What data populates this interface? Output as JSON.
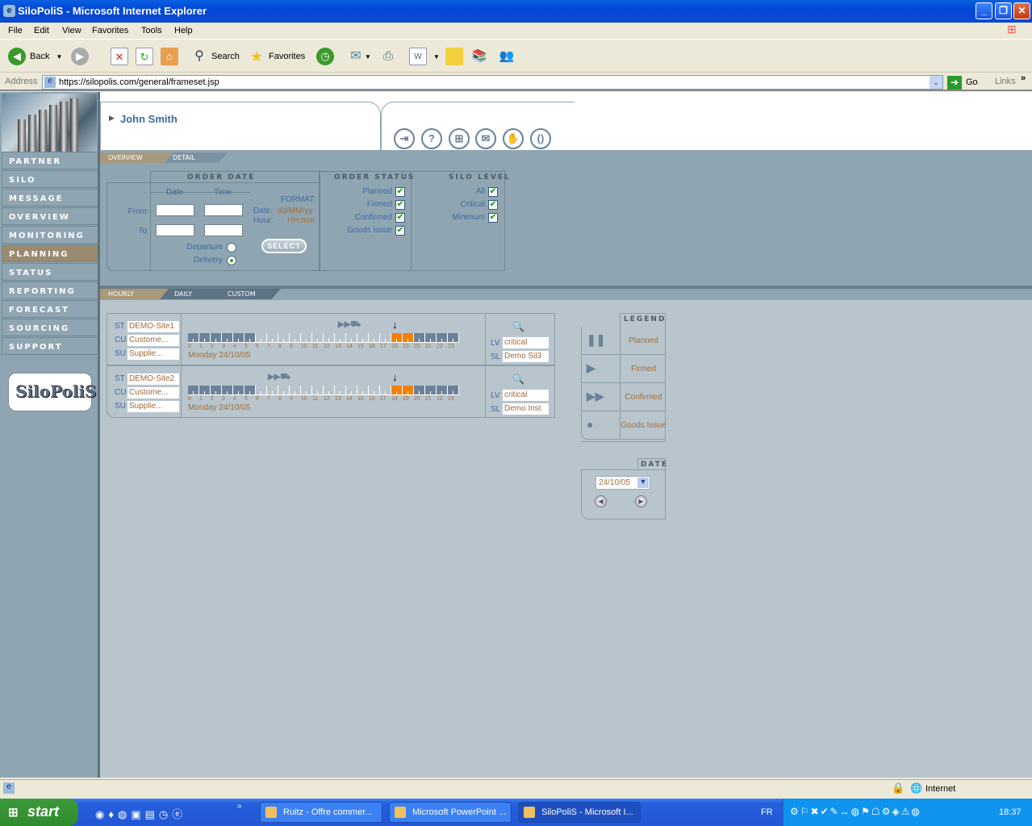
{
  "browser": {
    "title": "SiloPoliS - Microsoft Internet Explorer",
    "menu": [
      "File",
      "Edit",
      "View",
      "Favorites",
      "Tools",
      "Help"
    ],
    "toolbar": {
      "back": "Back",
      "search": "Search",
      "favorites": "Favorites"
    },
    "address_label": "Address",
    "url": "https://silopolis.com/general/frameset.jsp",
    "go": "Go",
    "links": "Links",
    "window_buttons": {
      "minimize": "_",
      "restore": "❐",
      "close": "✕"
    }
  },
  "sidebar": {
    "items": [
      {
        "label": "PARTNER",
        "active": false
      },
      {
        "label": "SILO",
        "active": false
      },
      {
        "label": "MESSAGE",
        "active": false
      },
      {
        "label": "OVERVIEW",
        "active": false
      },
      {
        "label": "MONITORING",
        "active": false
      },
      {
        "label": "PLANNING",
        "active": true
      },
      {
        "label": "STATUS",
        "active": false
      },
      {
        "label": "REPORTING",
        "active": false
      },
      {
        "label": "FORECAST",
        "active": false
      },
      {
        "label": "SOURCING",
        "active": false
      },
      {
        "label": "SUPPORT",
        "active": false
      }
    ],
    "brand": "SiloPoliS"
  },
  "header": {
    "user_name": "John Smith",
    "icons": [
      "logout-icon",
      "help-icon",
      "sitemap-icon",
      "mail-icon",
      "hand-icon",
      "refresh-icon"
    ]
  },
  "subtabs": {
    "overview": "OVERVIEW",
    "detail": "DETAIL"
  },
  "filters": {
    "order_date": {
      "title": "ORDER DATE",
      "date_col": "Date",
      "time_col": "Time",
      "from": "From",
      "to": "To",
      "from_date": "",
      "from_time": "",
      "to_date": "",
      "to_time": "",
      "departure": "Departure",
      "delivery": "Delivery",
      "selected": "Delivery"
    },
    "format": {
      "title": "FORMAT:",
      "date_label": "Date:",
      "date_value": "dd/MM/yy",
      "hour_label": "Hour:",
      "hour_value": "HH:mm"
    },
    "select_button": "SELECT",
    "order_status": {
      "title": "ORDER STATUS",
      "items": [
        {
          "label": "Planned",
          "checked": true
        },
        {
          "label": "Firmed",
          "checked": true
        },
        {
          "label": "Confirmed",
          "checked": true
        },
        {
          "label": "Goods issue",
          "checked": true
        }
      ]
    },
    "silo_level": {
      "title": "SILO LEVEL",
      "items": [
        {
          "label": "All",
          "checked": true
        },
        {
          "label": "Critical",
          "checked": true
        },
        {
          "label": "Minimum",
          "checked": true
        }
      ]
    }
  },
  "view_tabs": [
    "HOURLY",
    "DAILY",
    "CUSTOM"
  ],
  "planning": {
    "hours": [
      "0",
      "1",
      "2",
      "3",
      "4",
      "5",
      "6",
      "7",
      "8",
      "9",
      "10",
      "11",
      "12",
      "13",
      "14",
      "15",
      "16",
      "17",
      "18",
      "19",
      "20",
      "21",
      "22",
      "23"
    ],
    "rows": [
      {
        "st_label": "ST",
        "st": "DEMO-Site1",
        "cu_label": "CU",
        "cu": "Custome...",
        "su_label": "SU",
        "su": "Supplie...",
        "date": "Monday 24/10/05",
        "lv_label": "LV",
        "lv": "critical",
        "sl_label": "SL",
        "sl": "Demo Sil3",
        "status": "Confirmed",
        "delivery_hour": 18,
        "highlight_hours": [
          18,
          19
        ],
        "dark_hours": [
          0,
          1,
          2,
          3,
          4,
          5,
          20,
          21,
          22,
          23
        ]
      },
      {
        "st_label": "ST",
        "st": "DEMO-Site2",
        "cu_label": "CU",
        "cu": "Custome...",
        "su_label": "SU",
        "su": "Supplie...",
        "date": "Monday 24/10/05",
        "lv_label": "LV",
        "lv": "critical",
        "sl_label": "SL",
        "sl": "Demo Inst",
        "status": "Confirmed",
        "delivery_hour": 18,
        "highlight_hours": [
          18,
          19
        ],
        "dark_hours": [
          0,
          1,
          2,
          3,
          4,
          5,
          20,
          21,
          22,
          23
        ]
      }
    ]
  },
  "legend": {
    "title": "LEGEND",
    "items": [
      {
        "label": "Planned",
        "glyph": "❚❚"
      },
      {
        "label": "Firmed",
        "glyph": "▶"
      },
      {
        "label": "Confirmed",
        "glyph": "▶▶"
      },
      {
        "label": "Goods Issue",
        "glyph": "●"
      }
    ]
  },
  "date_panel": {
    "title": "DATE",
    "value": "24/10/05"
  },
  "colors": {
    "highlight": "#f57f00",
    "dark_hour": "#6c8299",
    "accent_text": "#3e6aa0",
    "value_text": "#a0703a",
    "active_nav": "#9b8a70"
  },
  "statusbar": {
    "zone": "Internet"
  },
  "taskbar": {
    "start": "start",
    "tasks": [
      {
        "label": "Ruitz - Offre commer...",
        "active": false
      },
      {
        "label": "Microsoft PowerPoint ...",
        "active": false
      },
      {
        "label": "SiloPoliS - Microsoft I...",
        "active": true
      }
    ],
    "lang": "FR",
    "clock": "18:37"
  }
}
